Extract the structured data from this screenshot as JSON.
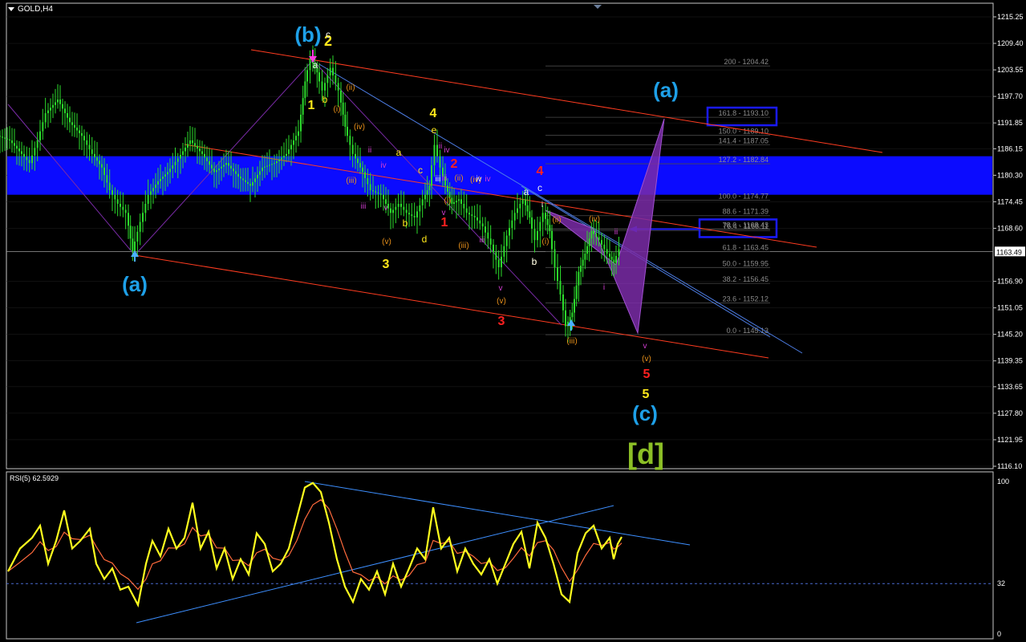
{
  "window": {
    "symbol_label": "GOLD,H4"
  },
  "colors": {
    "background": "#000000",
    "grid": "#202020",
    "candle": "#2cdc2c",
    "wave_yellow": "#ffe81a",
    "wave_cyan": "#1ea0e8",
    "wave_orange": "#e8901a",
    "wave_magenta": "#d23ed2",
    "wave_red": "#ff2020",
    "wave_white": "#f0f0f0",
    "wave_olive": "#8cbf26",
    "channel": "#ff3c20",
    "trendline": "#4e7fe8",
    "zone": "#0b0bff",
    "pattern": "#7a2ba7",
    "rsi_main": "#ffff1e",
    "rsi_signal": "#ff6a3c",
    "rsi_trend": "#3d8fff"
  },
  "chart_data": {
    "type": "candlestick",
    "symbol": "GOLD,H4",
    "price_axis": {
      "ticks": [
        "1215.25",
        "1209.40",
        "1203.55",
        "1197.70",
        "1191.85",
        "1186.15",
        "1180.30",
        "1174.45",
        "1168.60",
        "1163.49",
        "1156.90",
        "1151.05",
        "1145.20",
        "1139.35",
        "1133.65",
        "1127.80",
        "1121.95",
        "1116.10"
      ],
      "current_price": "1163.49",
      "range": [
        1116.1,
        1215.25
      ]
    },
    "price_path": [
      [
        0,
        1189
      ],
      [
        15,
        1188
      ],
      [
        30,
        1185
      ],
      [
        40,
        1183
      ],
      [
        50,
        1188
      ],
      [
        60,
        1194
      ],
      [
        75,
        1197
      ],
      [
        90,
        1192
      ],
      [
        105,
        1189
      ],
      [
        118,
        1185
      ],
      [
        130,
        1182
      ],
      [
        140,
        1177
      ],
      [
        150,
        1174
      ],
      [
        160,
        1172
      ],
      [
        168,
        1163.5
      ],
      [
        178,
        1170
      ],
      [
        188,
        1176
      ],
      [
        200,
        1179
      ],
      [
        212,
        1181
      ],
      [
        225,
        1184
      ],
      [
        240,
        1188
      ],
      [
        255,
        1185
      ],
      [
        270,
        1181
      ],
      [
        285,
        1183
      ],
      [
        300,
        1180
      ],
      [
        315,
        1178
      ],
      [
        330,
        1182
      ],
      [
        345,
        1183
      ],
      [
        360,
        1185
      ],
      [
        375,
        1190
      ],
      [
        383,
        1201
      ],
      [
        390,
        1206
      ],
      [
        398,
        1203
      ],
      [
        405,
        1199
      ],
      [
        415,
        1204
      ],
      [
        425,
        1199
      ],
      [
        433,
        1191
      ],
      [
        443,
        1185
      ],
      [
        455,
        1181
      ],
      [
        465,
        1177
      ],
      [
        478,
        1176
      ],
      [
        490,
        1172
      ],
      [
        500,
        1174
      ],
      [
        510,
        1172
      ],
      [
        520,
        1171
      ],
      [
        530,
        1175
      ],
      [
        538,
        1178
      ],
      [
        545,
        1187
      ],
      [
        552,
        1182
      ],
      [
        558,
        1178
      ],
      [
        566,
        1174
      ],
      [
        575,
        1175
      ],
      [
        585,
        1172
      ],
      [
        595,
        1171
      ],
      [
        605,
        1169
      ],
      [
        615,
        1165
      ],
      [
        625,
        1160
      ],
      [
        635,
        1167
      ],
      [
        645,
        1172
      ],
      [
        655,
        1175
      ],
      [
        663,
        1171
      ],
      [
        670,
        1166
      ],
      [
        680,
        1172
      ],
      [
        688,
        1168
      ],
      [
        695,
        1160
      ],
      [
        702,
        1154
      ],
      [
        708,
        1147
      ],
      [
        716,
        1150
      ],
      [
        724,
        1159
      ],
      [
        732,
        1163
      ],
      [
        740,
        1168
      ],
      [
        750,
        1166
      ],
      [
        760,
        1163
      ],
      [
        768,
        1161
      ],
      [
        775,
        1164
      ]
    ],
    "fibonacci": {
      "levels": [
        "200 - 1204.42",
        "161.8 - 1193.10",
        "150.0 - 1189.10",
        "141.4 - 1187.05",
        "127.2 - 1182.84",
        "100.0 - 1174.77",
        "88.6 - 1171.39",
        "78.6 - 1168.43",
        "76.4 - 1168.11",
        "61.8 - 1163.45",
        "50.0 - 1159.95",
        "38.2 - 1156.45",
        "23.6 - 1152.12",
        "0.0 - 1145.13"
      ],
      "prices": [
        1204.42,
        1193.1,
        1189.1,
        1187.05,
        1182.84,
        1174.77,
        1171.39,
        1168.43,
        1168.11,
        1163.45,
        1159.95,
        1156.45,
        1152.12,
        1145.13
      ],
      "highlighted": [
        "161.8 - 1193.10",
        "78.6 - 1168.43"
      ]
    },
    "zone": {
      "from": 1176.0,
      "to": 1184.5
    },
    "wave_labels": [
      {
        "text": "(b)",
        "color": "wave_cyan",
        "size": 26
      },
      {
        "text": "2",
        "color": "wave_yellow",
        "size": 18
      },
      {
        "text": "(a)",
        "color": "wave_cyan",
        "size": 26
      },
      {
        "text": "(a)",
        "color": "wave_cyan",
        "size": 26
      },
      {
        "text": "(c)",
        "color": "wave_cyan",
        "size": 26
      },
      {
        "text": "[d]",
        "color": "wave_olive",
        "size": 36
      },
      {
        "text": "1",
        "color": "wave_yellow",
        "size": 16
      },
      {
        "text": "3",
        "color": "wave_yellow",
        "size": 16
      },
      {
        "text": "4",
        "color": "wave_yellow",
        "size": 16
      },
      {
        "text": "5",
        "color": "wave_yellow",
        "size": 16
      },
      {
        "text": "a",
        "color": "wave_white",
        "size": 12
      },
      {
        "text": "b",
        "color": "wave_yellow",
        "size": 12
      },
      {
        "text": "c",
        "color": "wave_white",
        "size": 12
      },
      {
        "text": "a",
        "color": "wave_yellow",
        "size": 12
      },
      {
        "text": "b",
        "color": "wave_yellow",
        "size": 12
      },
      {
        "text": "c",
        "color": "wave_yellow",
        "size": 12
      },
      {
        "text": "d",
        "color": "wave_yellow",
        "size": 12
      },
      {
        "text": "e",
        "color": "wave_yellow",
        "size": 12
      },
      {
        "text": "a",
        "color": "wave_white",
        "size": 12
      },
      {
        "text": "b",
        "color": "wave_yellow",
        "size": 12
      },
      {
        "text": "c",
        "color": "wave_white",
        "size": 12
      },
      {
        "text": "(i)",
        "color": "wave_orange",
        "size": 10
      },
      {
        "text": "(ii)",
        "color": "wave_orange",
        "size": 10
      },
      {
        "text": "(iii)",
        "color": "wave_orange",
        "size": 10
      },
      {
        "text": "(iv)",
        "color": "wave_orange",
        "size": 10
      },
      {
        "text": "(v)",
        "color": "wave_orange",
        "size": 10
      },
      {
        "text": "(i)",
        "color": "wave_orange",
        "size": 10
      },
      {
        "text": "(ii)",
        "color": "wave_orange",
        "size": 10
      },
      {
        "text": "(iii)",
        "color": "wave_orange",
        "size": 10
      },
      {
        "text": "(iv)",
        "color": "wave_orange",
        "size": 10
      },
      {
        "text": "(v)",
        "color": "wave_orange",
        "size": 10
      },
      {
        "text": "(i)",
        "color": "wave_orange",
        "size": 10
      },
      {
        "text": "(ii)",
        "color": "wave_orange",
        "size": 10
      },
      {
        "text": "(iii)",
        "color": "wave_orange",
        "size": 10
      },
      {
        "text": "(iv)",
        "color": "wave_orange",
        "size": 10
      },
      {
        "text": "(v)",
        "color": "wave_orange",
        "size": 10
      },
      {
        "text": "iii",
        "color": "wave_magenta",
        "size": 10
      },
      {
        "text": "iv",
        "color": "wave_magenta",
        "size": 10
      },
      {
        "text": "v",
        "color": "wave_magenta",
        "size": 10
      },
      {
        "text": "ii",
        "color": "wave_magenta",
        "size": 10
      },
      {
        "text": "iii",
        "color": "wave_magenta",
        "size": 10
      },
      {
        "text": "ii",
        "color": "wave_magenta",
        "size": 10
      },
      {
        "text": "v",
        "color": "wave_magenta",
        "size": 10
      },
      {
        "text": "iv",
        "color": "wave_magenta",
        "size": 10
      },
      {
        "text": "iii",
        "color": "wave_magenta",
        "size": 10
      },
      {
        "text": "iv",
        "color": "wave_magenta",
        "size": 10
      },
      {
        "text": "ii",
        "color": "wave_magenta",
        "size": 10
      },
      {
        "text": "i",
        "color": "wave_magenta",
        "size": 10
      },
      {
        "text": "v",
        "color": "wave_magenta",
        "size": 10
      },
      {
        "text": "v",
        "color": "wave_magenta",
        "size": 10
      },
      {
        "text": "1",
        "color": "wave_red",
        "size": 16
      },
      {
        "text": "2",
        "color": "wave_red",
        "size": 16
      },
      {
        "text": "3",
        "color": "wave_red",
        "size": 16
      },
      {
        "text": "4",
        "color": "wave_red",
        "size": 16
      },
      {
        "text": "5",
        "color": "wave_red",
        "size": 16
      },
      {
        "text": "iii",
        "color": "wave_white",
        "size": 10
      },
      {
        "text": "iv",
        "color": "wave_white",
        "size": 10
      },
      {
        "text": "i",
        "color": "wave_white",
        "size": 10
      },
      {
        "text": "b",
        "color": "wave_white",
        "size": 12
      }
    ]
  },
  "rsi": {
    "label": "RSI(5) 62.5929",
    "period": 5,
    "value": 62.5929,
    "axis_ticks": [
      "100",
      "32",
      "0"
    ],
    "level": 32,
    "path": [
      [
        10,
        40
      ],
      [
        25,
        55
      ],
      [
        40,
        62
      ],
      [
        50,
        70
      ],
      [
        60,
        45
      ],
      [
        70,
        60
      ],
      [
        80,
        80
      ],
      [
        90,
        55
      ],
      [
        100,
        60
      ],
      [
        112,
        68
      ],
      [
        120,
        45
      ],
      [
        130,
        35
      ],
      [
        140,
        42
      ],
      [
        150,
        28
      ],
      [
        160,
        30
      ],
      [
        172,
        18
      ],
      [
        182,
        45
      ],
      [
        190,
        60
      ],
      [
        200,
        50
      ],
      [
        210,
        68
      ],
      [
        220,
        55
      ],
      [
        230,
        62
      ],
      [
        240,
        85
      ],
      [
        250,
        55
      ],
      [
        260,
        66
      ],
      [
        270,
        42
      ],
      [
        280,
        55
      ],
      [
        290,
        35
      ],
      [
        300,
        48
      ],
      [
        310,
        38
      ],
      [
        320,
        65
      ],
      [
        330,
        58
      ],
      [
        340,
        40
      ],
      [
        350,
        45
      ],
      [
        360,
        55
      ],
      [
        370,
        75
      ],
      [
        380,
        95
      ],
      [
        390,
        98
      ],
      [
        400,
        92
      ],
      [
        410,
        72
      ],
      [
        420,
        48
      ],
      [
        430,
        30
      ],
      [
        440,
        20
      ],
      [
        450,
        35
      ],
      [
        460,
        28
      ],
      [
        470,
        40
      ],
      [
        480,
        25
      ],
      [
        490,
        45
      ],
      [
        500,
        30
      ],
      [
        510,
        42
      ],
      [
        520,
        55
      ],
      [
        530,
        48
      ],
      [
        540,
        82
      ],
      [
        550,
        55
      ],
      [
        560,
        62
      ],
      [
        570,
        40
      ],
      [
        580,
        55
      ],
      [
        590,
        45
      ],
      [
        600,
        38
      ],
      [
        610,
        48
      ],
      [
        620,
        32
      ],
      [
        630,
        45
      ],
      [
        640,
        58
      ],
      [
        650,
        66
      ],
      [
        660,
        42
      ],
      [
        670,
        72
      ],
      [
        680,
        62
      ],
      [
        690,
        45
      ],
      [
        700,
        25
      ],
      [
        710,
        20
      ],
      [
        720,
        52
      ],
      [
        730,
        65
      ],
      [
        740,
        70
      ],
      [
        750,
        55
      ],
      [
        760,
        62
      ],
      [
        765,
        48
      ],
      [
        770,
        58
      ],
      [
        775,
        62.6
      ]
    ]
  }
}
